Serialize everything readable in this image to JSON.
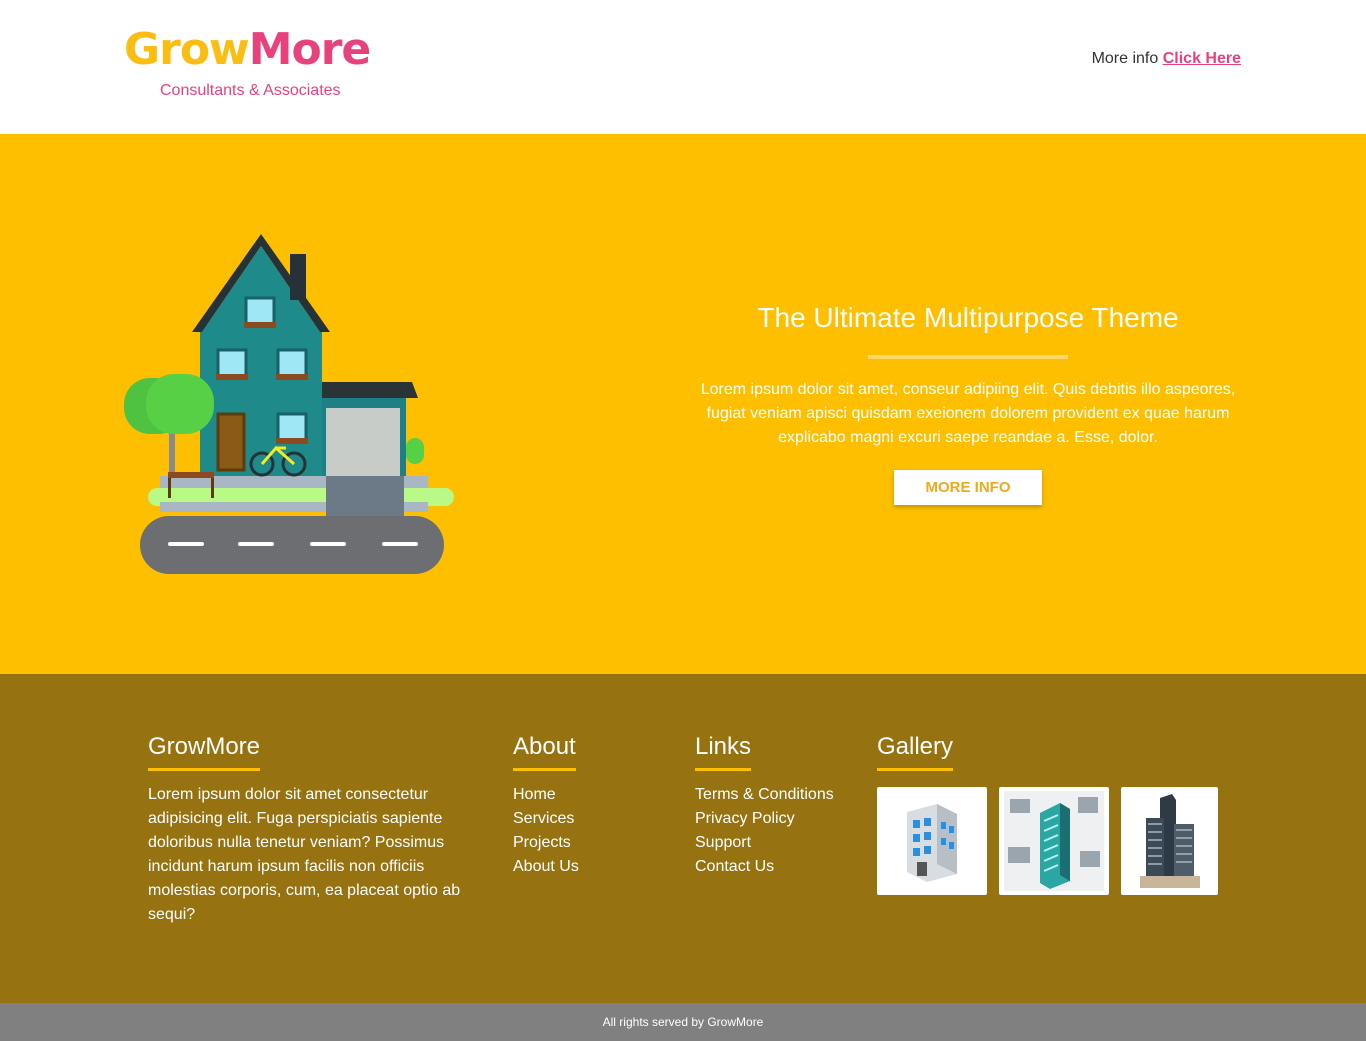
{
  "header": {
    "logo_part1": "Grow",
    "logo_part2": "More",
    "tagline": "Consultants & Associates",
    "more_info_text": "More info",
    "click_here": "Click Here"
  },
  "hero": {
    "title": "The Ultimate Multipurpose Theme",
    "text": "Lorem ipsum dolor sit amet, conseur adipiing elit. Quis debitis illo aspeores, fugiat veniam apisci quisdam exeionem dolorem provident ex quae harum explicabo magni excuri saepe reandae a. Esse, dolor.",
    "button": "More Info"
  },
  "footer": {
    "brand": {
      "title": "GrowMore",
      "text": "Lorem ipsum dolor sit amet consectetur adipisicing elit. Fuga perspiciatis sapiente doloribus nulla tenetur veniam? Possimus incidunt harum ipsum facilis non officiis molestias corporis, cum, ea placeat optio ab sequi?"
    },
    "about": {
      "title": "About",
      "items": [
        "Home",
        "Services",
        "Projects",
        "About Us"
      ]
    },
    "links": {
      "title": "Links",
      "items": [
        "Terms & Conditions",
        "Privacy Policy",
        "Support",
        "Contact Us"
      ]
    },
    "gallery": {
      "title": "Gallery"
    }
  },
  "copyright": "All rights served by GrowMore",
  "colors": {
    "brand_yellow": "#fdbf00",
    "brand_pink": "#e7427e",
    "footer_bg": "#977211",
    "copyright_bg": "#808080"
  }
}
